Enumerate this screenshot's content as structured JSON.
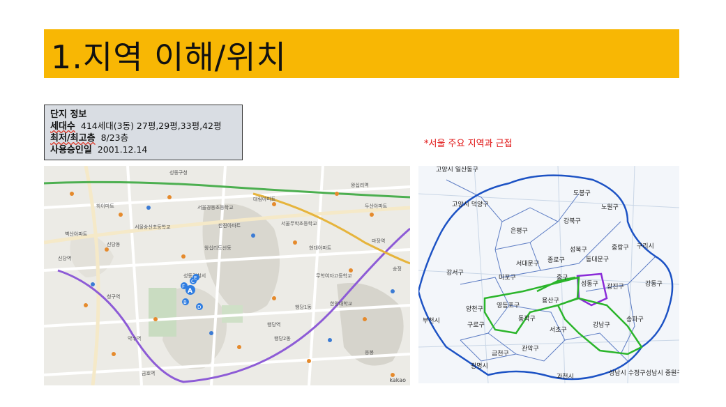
{
  "title": "1.지역 이해/위치",
  "info": {
    "heading": "단지 정보",
    "rows": [
      {
        "key": "세대수",
        "value": "414세대(3동) 27평,29평,33평,42평"
      },
      {
        "key": "최저/최고층",
        "value": "8/23층"
      },
      {
        "key": "사용승인일",
        "value": "2001.12.14"
      }
    ]
  },
  "note": "*서울 주요 지역과 근접",
  "left_map": {
    "watermark": "kakao",
    "labels": [
      "성동구청",
      "하이마트",
      "서울숭신초등학교",
      "서울경동초등학교",
      "서울무학초등학교",
      "대림아파트",
      "벽산아파트",
      "한진아파트",
      "현대아파트",
      "왕십리역",
      "행당역",
      "마장역",
      "무학여자고등학교",
      "한양대학교",
      "성동경찰서",
      "신당역",
      "청구역",
      "약수역",
      "금호역",
      "두산아파트",
      "응봉",
      "송정",
      "행당1동",
      "행당2동",
      "왕십리도선동",
      "신당동"
    ],
    "marker_labels": [
      "A",
      "B",
      "C",
      "D",
      "E",
      "F"
    ]
  },
  "right_map": {
    "districts": [
      "고양시 일산동구",
      "고양시 덕양구",
      "도봉구",
      "노원구",
      "강북구",
      "은평구",
      "성북구",
      "중랑구",
      "구리시",
      "종로구",
      "동대문구",
      "서대문구",
      "강서구",
      "마포구",
      "중구",
      "성동구",
      "광진구",
      "강동구",
      "양천구",
      "영등포구",
      "용산구",
      "동작구",
      "송파구",
      "부천시",
      "구로구",
      "서초구",
      "강남구",
      "금천구",
      "관악구",
      "광명시",
      "과천시",
      "성남시 수정구",
      "성남시 중원구"
    ]
  },
  "colors": {
    "title_bg": "#f8b704",
    "info_bg": "#d9dde3",
    "note_color": "#e01010",
    "boundary_blue": "#1c52c4",
    "highlight_green": "#2bb52b",
    "highlight_purple": "#8a2bd8"
  }
}
